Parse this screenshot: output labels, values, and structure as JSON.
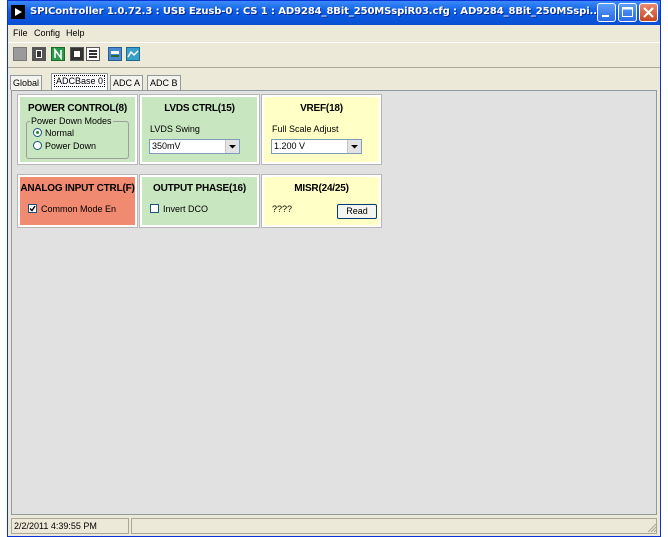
{
  "window": {
    "title": "SPIController 1.0.72.3 : USB Ezusb-0 : CS 1 : AD9284_8Bit_250MSspiR03.cfg : AD9284_8Bit_250MSspi..."
  },
  "menu": {
    "items": [
      "File",
      "Config",
      "Help"
    ]
  },
  "toolbar": {
    "icons": [
      "gray-square-icon",
      "chip-icon",
      "n-icon",
      "chip-dark-icon",
      "register-icon",
      "usb-icon",
      "graph-icon"
    ]
  },
  "tabs": [
    "Global",
    "ADCBase 0",
    "ADC A",
    "ADC B"
  ],
  "active_tab": "ADCBase 0",
  "panels": {
    "power_control": {
      "title": "POWER CONTROL(8)",
      "group_label": "Power Down Modes",
      "options": [
        "Normal",
        "Power Down"
      ],
      "selected": "Normal"
    },
    "lvds_ctrl": {
      "title": "LVDS CTRL(15)",
      "label": "LVDS Swing",
      "value": "350mV"
    },
    "vref": {
      "title": "VREF(18)",
      "label": "Full Scale Adjust",
      "value": "1.200 V"
    },
    "analog_input": {
      "title": "ANALOG INPUT CTRL(F)",
      "checkbox_label": "Common Mode En",
      "checked": true
    },
    "output_phase": {
      "title": "OUTPUT PHASE(16)",
      "checkbox_label": "Invert DCO",
      "checked": false
    },
    "misr": {
      "title": "MISR(24/25)",
      "value": "????",
      "button_label": "Read"
    }
  },
  "colors": {
    "green_panel": "#c8e6bf",
    "yellow_panel": "#ffffc6",
    "red_panel": "#f08a70",
    "titlebar": "#0b5ee8"
  },
  "status": {
    "timestamp": "2/2/2011 4:39:55 PM"
  }
}
